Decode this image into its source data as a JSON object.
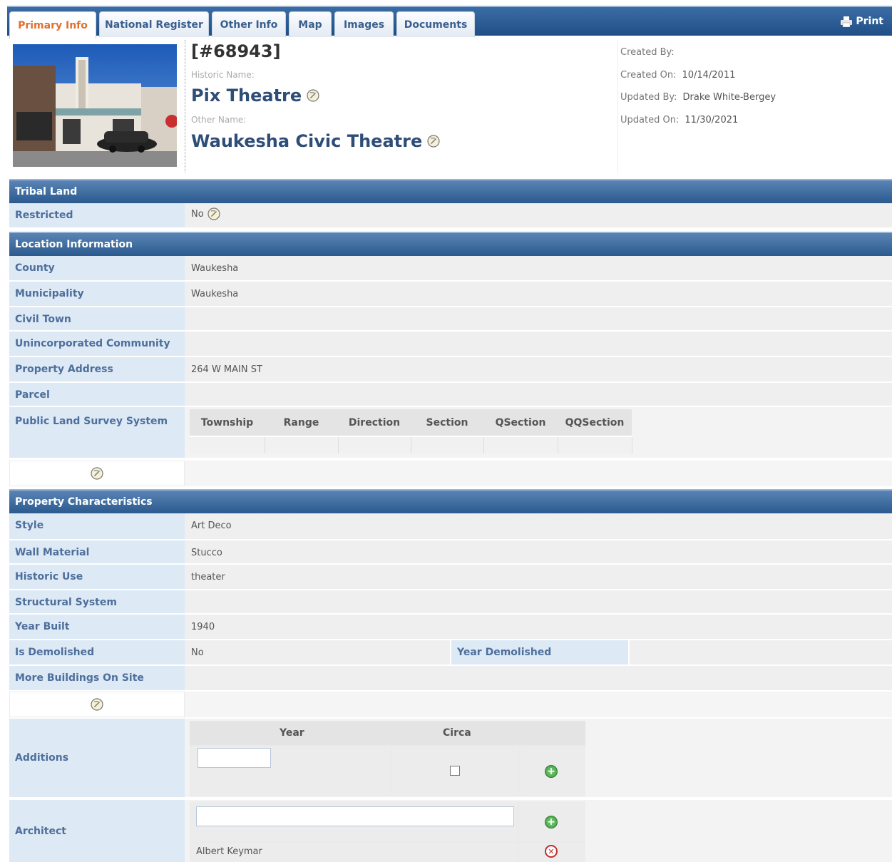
{
  "tabs": [
    {
      "label": "Primary Info",
      "active": true
    },
    {
      "label": "National Register",
      "active": false
    },
    {
      "label": "Other Info",
      "active": false
    },
    {
      "label": "Map",
      "active": false
    },
    {
      "label": "Images",
      "active": false
    },
    {
      "label": "Documents",
      "active": false
    }
  ],
  "print_label": "Print",
  "header": {
    "site_id": "[#68943]",
    "historic_name_label": "Historic Name:",
    "historic_name": "Pix Theatre",
    "other_name_label": "Other Name:",
    "other_name": "Waukesha Civic Theatre",
    "created_by_label": "Created By:",
    "created_by": "",
    "created_on_label": "Created On:",
    "created_on": "10/14/2011",
    "updated_by_label": "Updated By:",
    "updated_by": "Drake White-Bergey",
    "updated_on_label": "Updated On:",
    "updated_on": "11/30/2021"
  },
  "tribal": {
    "section_title": "Tribal Land",
    "restricted_label": "Restricted",
    "restricted_value": "No"
  },
  "location": {
    "section_title": "Location Information",
    "county_label": "County",
    "county": "Waukesha",
    "municipality_label": "Municipality",
    "municipality": "Waukesha",
    "civil_town_label": "Civil Town",
    "civil_town": "",
    "unincorporated_label": "Unincorporated Community",
    "unincorporated": "",
    "address_label": "Property Address",
    "address": "264 W MAIN ST",
    "parcel_label": "Parcel",
    "parcel": "",
    "plss_label": "Public Land Survey System",
    "plss_headers": [
      "Township",
      "Range",
      "Direction",
      "Section",
      "QSection",
      "QQSection"
    ]
  },
  "characteristics": {
    "section_title": "Property Characteristics",
    "style_label": "Style",
    "style": "Art Deco",
    "wall_label": "Wall Material",
    "wall": "Stucco",
    "use_label": "Historic Use",
    "use": "theater",
    "structural_label": "Structural System",
    "structural": "",
    "year_label": "Year Built",
    "year": "1940",
    "demolished_label": "Is Demolished",
    "demolished": "No",
    "year_demolished_label": "Year Demolished",
    "year_demolished": "",
    "more_buildings_label": "More Buildings On Site",
    "more_buildings": "",
    "additions_label": "Additions",
    "additions_year_header": "Year",
    "additions_circa_header": "Circa",
    "architect_label": "Architect",
    "architect_input_value": "",
    "architects": [
      "Albert Keymar"
    ]
  },
  "colors": {
    "section_bg": "#2b5a8f",
    "label_bg": "#dde9f5",
    "label_text": "#4e6f9c",
    "active_tab_text": "#e07030"
  },
  "icons": {
    "edit": "edit-note-icon",
    "print": "printer-icon",
    "add": "green-plus-icon",
    "delete": "red-delete-icon"
  }
}
